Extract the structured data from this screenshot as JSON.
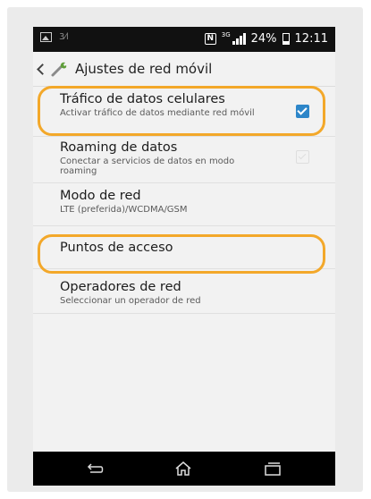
{
  "status_bar": {
    "battery_percent": "24%",
    "time": "12:11",
    "network_tag": "3G"
  },
  "action_bar": {
    "title": "Ajustes de red móvil"
  },
  "settings": [
    {
      "title": "Tráfico de datos celulares",
      "summary": "Activar tráfico de datos mediante red móvil",
      "checkbox": "checked"
    },
    {
      "title": "Roaming de datos",
      "summary": "Conectar a servicios de datos en modo roaming",
      "checkbox": "unchecked-disabled"
    },
    {
      "title": "Modo de red",
      "summary": "LTE (preferida)/WCDMA/GSM"
    },
    {
      "title": "Puntos de acceso",
      "summary": ""
    },
    {
      "title": "Operadores de red",
      "summary": "Seleccionar un operador de red"
    }
  ],
  "colors": {
    "accent": "#2d86c9",
    "highlight": "#f3a82a"
  }
}
